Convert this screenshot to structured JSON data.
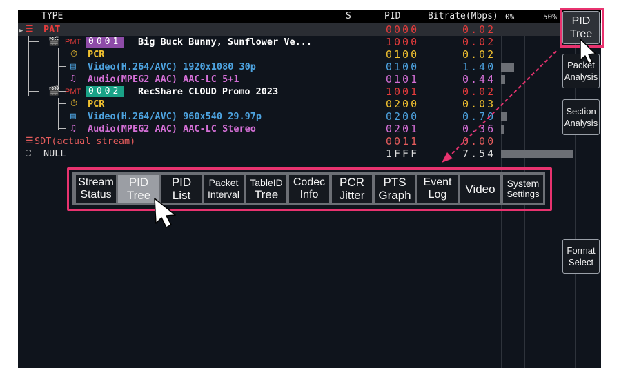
{
  "header": {
    "col_type": "TYPE",
    "col_s": "S",
    "col_pid": "PID",
    "col_bitrate": "Bitrate(Mbps)",
    "scale_0": "0%",
    "scale_50": "50%"
  },
  "rows": [
    {
      "label": "PAT",
      "pid": "0000",
      "bitrate": "0.02",
      "bar_pct": 0
    },
    {
      "pmt_badge": "PMT",
      "program": "0001",
      "label": "Big Buck Bunny, Sunflower Ve...",
      "pid": "1000",
      "bitrate": "0.02",
      "bar_pct": 0
    },
    {
      "label": "PCR",
      "pid": "0100",
      "bitrate": "0.02",
      "bar_pct": 0
    },
    {
      "label": "Video(H.264/AVC) 1920x1080 30p",
      "pid": "0100",
      "bitrate": "1.40",
      "bar_pct": 18
    },
    {
      "label": "Audio(MPEG2 AAC) AAC-LC 5+1",
      "pid": "0101",
      "bitrate": "0.44",
      "bar_pct": 6
    },
    {
      "pmt_badge": "PMT",
      "program": "0002",
      "label": "RecShare CLOUD Promo 2023",
      "pid": "1001",
      "bitrate": "0.02",
      "bar_pct": 0
    },
    {
      "label": "PCR",
      "pid": "0200",
      "bitrate": "0.03",
      "bar_pct": 0
    },
    {
      "label": "Video(H.264/AVC) 960x540 29.97p",
      "pid": "0200",
      "bitrate": "0.70",
      "bar_pct": 9
    },
    {
      "label": "Audio(MPEG2 AAC) AAC-LC Stereo",
      "pid": "0201",
      "bitrate": "0.36",
      "bar_pct": 5
    },
    {
      "label": "SDT(actual stream)",
      "pid": "0011",
      "bitrate": "0.00",
      "bar_pct": 0
    },
    {
      "label": "NULL",
      "pid": "1FFF",
      "bitrate": "7.54",
      "bar_pct": 100
    }
  ],
  "side_buttons": [
    {
      "l1": "PID",
      "l2": "Tree",
      "active": true
    },
    {
      "l1": "Packet",
      "l2": "Analysis"
    },
    {
      "l1": "Section",
      "l2": "Analysis"
    },
    {
      "l1": "Format",
      "l2": "Select"
    }
  ],
  "menu": [
    {
      "l1": "Stream",
      "l2": "Status"
    },
    {
      "l1": "PID",
      "l2": "Tree",
      "active": true
    },
    {
      "l1": "PID",
      "l2": "List"
    },
    {
      "l1": "Packet",
      "l2": "Interval"
    },
    {
      "l1": "TableID",
      "l2": "Tree"
    },
    {
      "l1": "Codec",
      "l2": "Info"
    },
    {
      "l1": "PCR",
      "l2": "Jitter"
    },
    {
      "l1": "PTS",
      "l2": "Graph"
    },
    {
      "l1": "Event",
      "l2": "Log"
    },
    {
      "l1": "Video",
      "l2": ""
    },
    {
      "l1": "System",
      "l2": "Settings"
    }
  ],
  "colors": {
    "pat_red": "#e53c3c",
    "pcr_yellow": "#f2c230",
    "video_blue": "#4da3e0",
    "audio_pink": "#d46fd6",
    "sdt_red": "#e45c5c",
    "program1_badge": "#8e4ca8",
    "program2_badge": "#1aa287",
    "highlight_pink": "#e8336f",
    "white": "#ffffff"
  }
}
